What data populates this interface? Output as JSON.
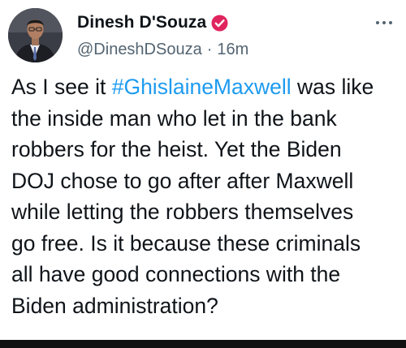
{
  "author": {
    "display_name": "Dinesh D'Souza",
    "handle": "@DineshDSouza",
    "separator": "·",
    "time_ago": "16m",
    "verified_color": "#e0245e"
  },
  "tweet": {
    "line1_prefix": "As I see it ",
    "hashtag": "#GhislaineMaxwell",
    "line1_suffix": " was like",
    "rest": "the inside man who let in the bank\nrobbers for the heist. Yet the Biden\nDOJ chose to go after after Maxwell\nwhile letting the robbers themselves\ngo free. Is it because these criminals\nall have good connections with the\nBiden administration?"
  },
  "icons": {
    "avatar": "profile-photo",
    "verified": "verified-badge-icon",
    "more": "more-options-icon"
  }
}
